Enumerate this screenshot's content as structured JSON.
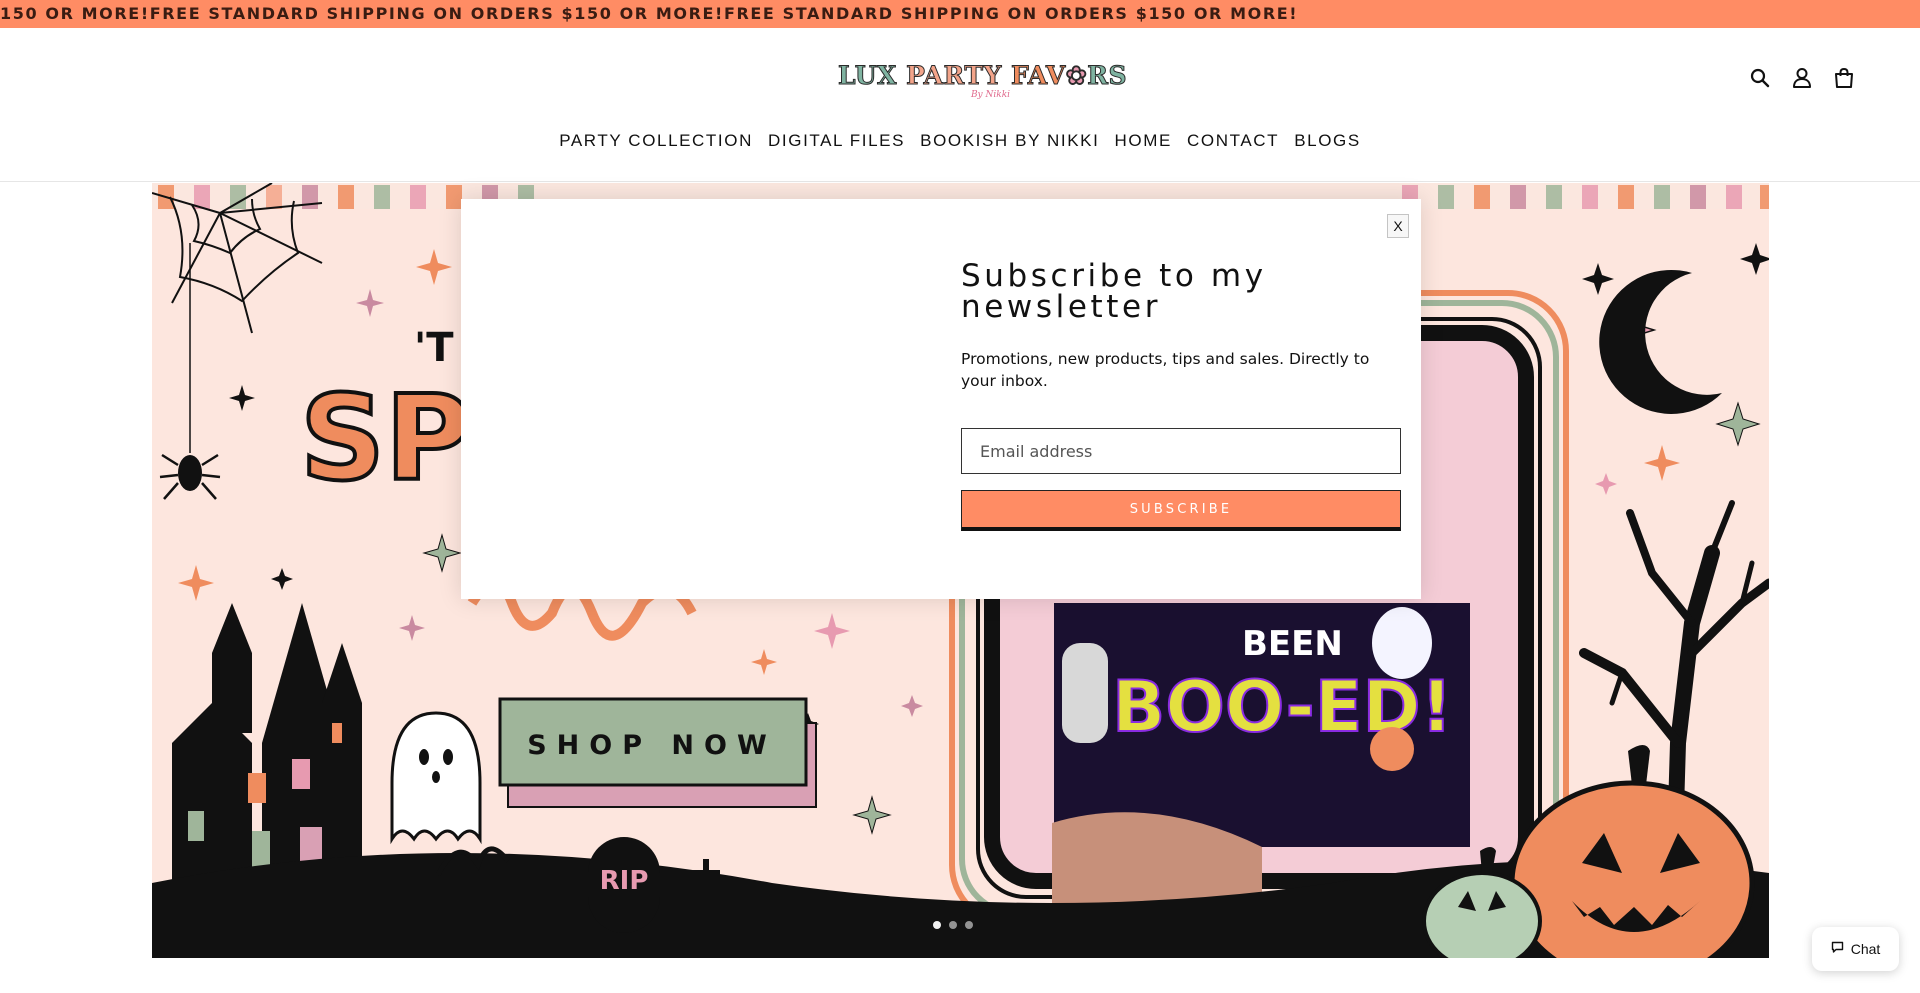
{
  "announcement": {
    "text": "150 OR MORE!FREE STANDARD SHIPPING ON ORDERS $150 OR MORE!FREE STANDARD SHIPPING ON ORDERS $150 OR MORE!"
  },
  "header": {
    "logo_text": "LUX PARTY FAVORS",
    "logo_subtext": "By Nikki",
    "icons": [
      "search-icon",
      "account-icon",
      "cart-icon"
    ]
  },
  "nav": {
    "items": [
      {
        "label": "PARTY COLLECTION"
      },
      {
        "label": "DIGITAL FILES"
      },
      {
        "label": "BOOKISH BY NIKKI"
      },
      {
        "label": "HOME"
      },
      {
        "label": "CONTACT"
      },
      {
        "label": "BLOGS"
      }
    ]
  },
  "hero": {
    "headline_fragments": [
      "'T",
      "SP"
    ],
    "cta_label": "SHOP NOW",
    "card_text_line1": "BEEN",
    "card_text_line2": "BOO-ED!",
    "tombstone_text": "RIP",
    "slide_count": 3,
    "active_slide": 1
  },
  "modal": {
    "close_label": "X",
    "heading": "Subscribe to my newsletter",
    "body": "Promotions, new products, tips and sales. Directly to your inbox.",
    "email_placeholder": "Email address",
    "subscribe_label": "SUBSCRIBE"
  },
  "chat": {
    "label": "Chat"
  },
  "colors": {
    "accent": "#ff8c64",
    "hero_bg": "#fde6de",
    "sage": "#9fb59a"
  }
}
